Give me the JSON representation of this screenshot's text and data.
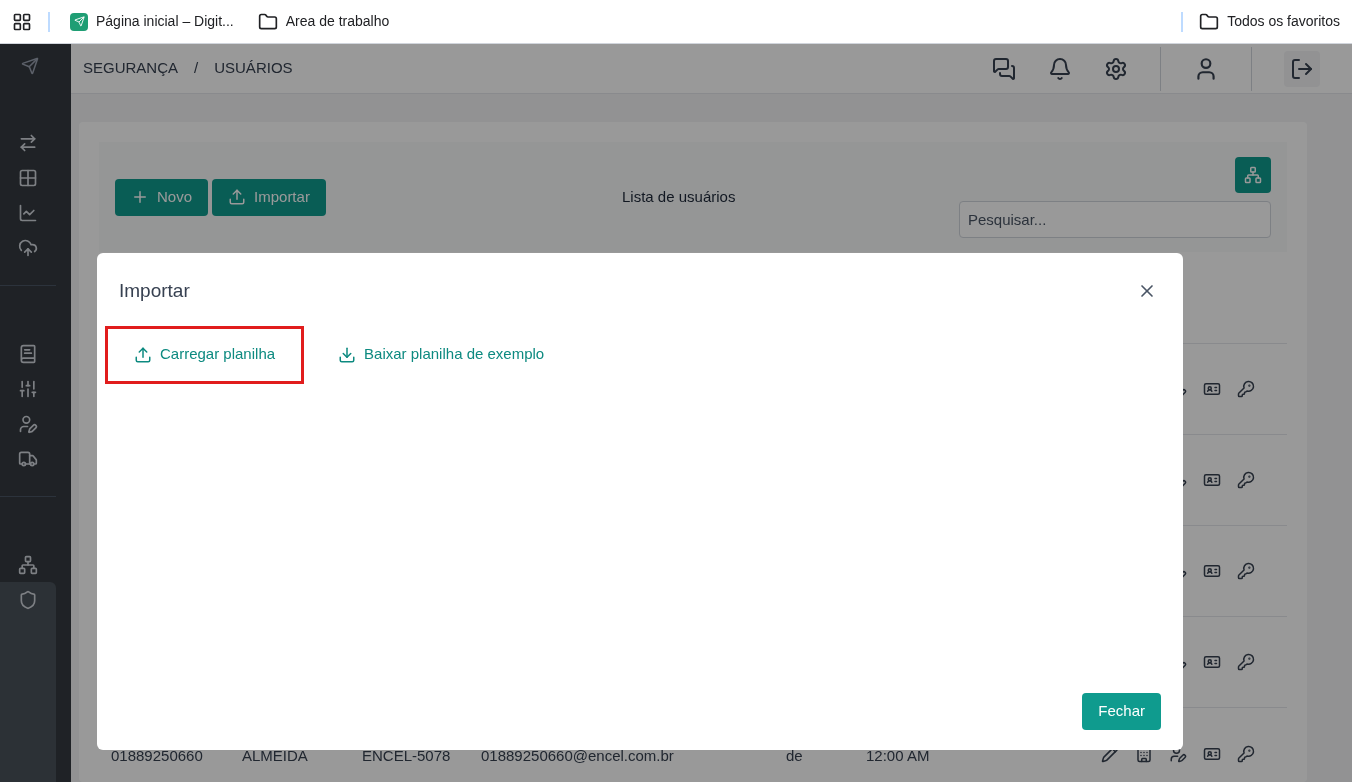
{
  "bookmarks_bar": {
    "items": [
      {
        "kind": "page",
        "label": "Página inicial – Digit..."
      },
      {
        "kind": "folder",
        "label": "Area de trabalho"
      }
    ],
    "all_bookmarks": "Todos os favoritos"
  },
  "sidebar": {
    "groups": [
      [
        {
          "kind": "transfer",
          "selected": false
        },
        {
          "kind": "grid",
          "selected": false
        },
        {
          "kind": "chart",
          "selected": false
        },
        {
          "kind": "upload",
          "selected": false
        }
      ],
      [
        {
          "kind": "book",
          "selected": false
        },
        {
          "kind": "sliders",
          "selected": false
        },
        {
          "kind": "user-edit",
          "selected": false
        },
        {
          "kind": "truck",
          "selected": false
        }
      ],
      [
        {
          "kind": "network",
          "selected": false
        },
        {
          "kind": "shield",
          "selected": true
        }
      ]
    ]
  },
  "breadcrumb": [
    "SEGURANÇA",
    "/",
    "USUÁRIOS"
  ],
  "toolbar": {
    "new_button": "Novo",
    "import_button": "Importar",
    "title": "Lista de usuários",
    "search": {
      "placeholder": "Pesquisar..."
    }
  },
  "table": {
    "rows": [
      {
        "cells": [
          "01889250660",
          "ALMEIDA",
          "ENCEL-5078",
          "01889250660@encel.com.br",
          "de",
          "12:00 AM"
        ]
      }
    ]
  },
  "dialog": {
    "title": "Importar",
    "actions": [
      {
        "kind": "upload",
        "label": "Carregar planilha",
        "highlighted": true
      },
      {
        "kind": "download",
        "label": "Baixar planilha de exemplo",
        "highlighted": false
      }
    ],
    "close_button": "Fechar"
  }
}
